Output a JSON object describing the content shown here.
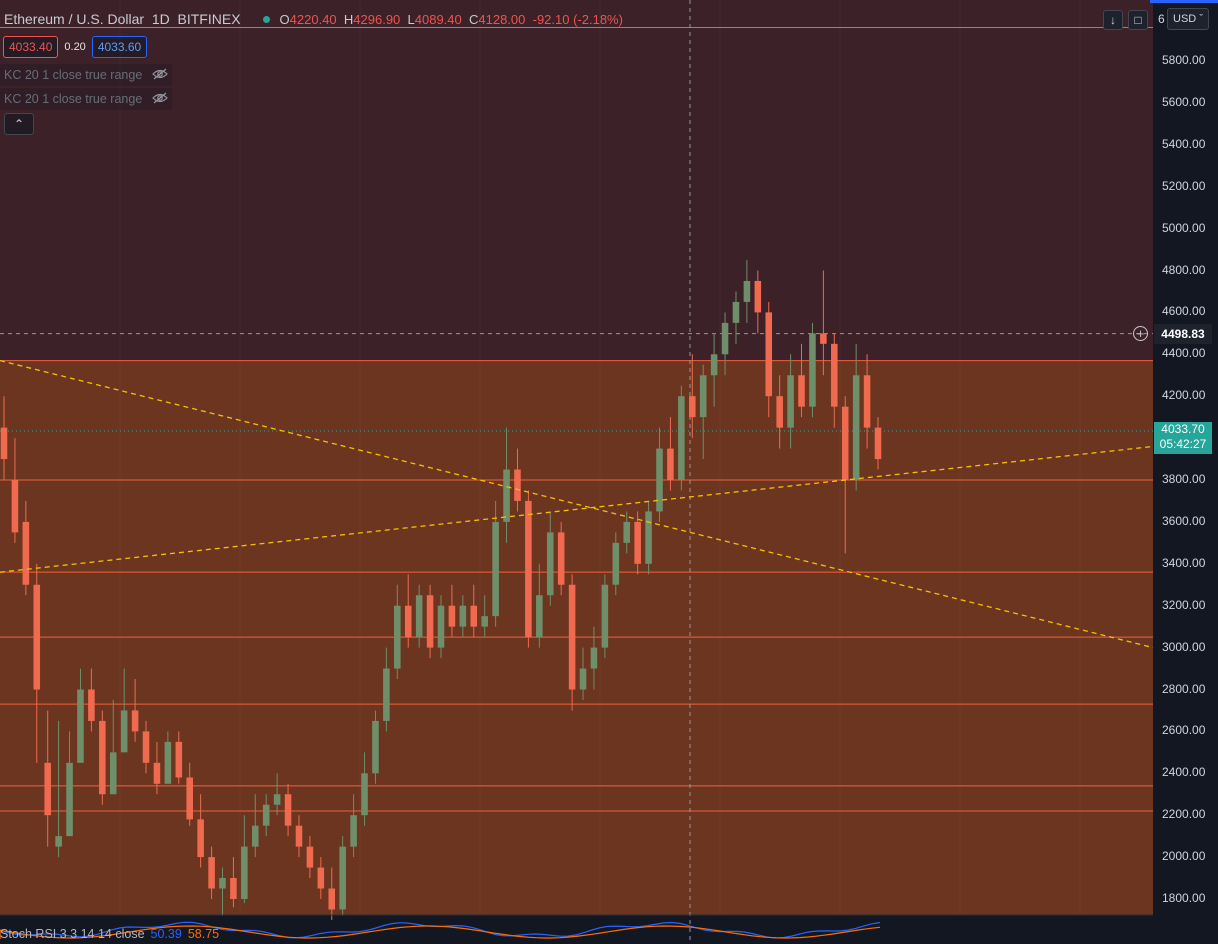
{
  "header": {
    "symbol": "Ethereum / U.S. Dollar",
    "interval": "1D",
    "exchange": "BITFINEX",
    "open_key": "O",
    "open_val": "4220.40",
    "high_key": "H",
    "high_val": "4296.90",
    "low_key": "L",
    "low_val": "4089.40",
    "close_key": "C",
    "close_val": "4128.00",
    "change": "-92.10 (-2.18%)"
  },
  "trade": {
    "bid": "4033.40",
    "spread": "0.20",
    "ask": "4033.60"
  },
  "indicators": [
    "KC 20 1 close true range",
    "KC 20 1 close true range"
  ],
  "currency": "USD",
  "axis": {
    "top_digit": "6",
    "labels": [
      "5800.00",
      "5600.00",
      "5400.00",
      "5200.00",
      "5000.00",
      "4800.00",
      "4600.00",
      "4400.00",
      "4200.00",
      "3800.00",
      "3600.00",
      "3400.00",
      "3200.00",
      "3000.00",
      "2800.00",
      "2600.00",
      "2400.00",
      "2200.00",
      "2000.00",
      "1800.00"
    ]
  },
  "crosshair_price": "4498.83",
  "last_price": "4033.70",
  "countdown": "05:42:27",
  "stoch": {
    "label": "Stoch RSI 3 3 14 14 close",
    "k": "50.39",
    "d": "58.75"
  },
  "colors": {
    "background": "#131722",
    "upper_zone": "#3c2128",
    "lower_zone": "#6b3520",
    "up_candle": "#6f8f6a",
    "down_candle": "#f06a4f",
    "level_line": "#f2613d",
    "trendline": "#f5c100",
    "last_price_tag": "#26a69a"
  },
  "chart_data": {
    "type": "candlestick",
    "symbol": "Ethereum / U.S. Dollar",
    "interval": "1D",
    "y_range": [
      1700,
      6000
    ],
    "horizontal_levels": [
      5960,
      4370,
      3800,
      3360,
      3050,
      2730,
      2340,
      2220
    ],
    "trendlines": [
      {
        "from": [
          0,
          4370
        ],
        "to": [
          1.0,
          3000
        ]
      },
      {
        "from": [
          0,
          3360
        ],
        "to": [
          1.0,
          3960
        ]
      }
    ],
    "last_price": 4033.7,
    "crosshair_price": 4498.83,
    "candles": [
      [
        4050,
        4200,
        3900,
        3800
      ],
      [
        3800,
        4000,
        3550,
        3500
      ],
      [
        3600,
        3700,
        3300,
        3250
      ],
      [
        3300,
        3400,
        2800,
        2450
      ],
      [
        2450,
        2700,
        2200,
        2050
      ],
      [
        2050,
        2650,
        2100,
        2000
      ],
      [
        2100,
        2600,
        2450,
        2400
      ],
      [
        2450,
        2900,
        2800,
        2700
      ],
      [
        2800,
        2900,
        2650,
        2600
      ],
      [
        2650,
        2700,
        2300,
        2250
      ],
      [
        2300,
        2750,
        2500,
        2450
      ],
      [
        2500,
        2900,
        2700,
        2650
      ],
      [
        2700,
        2850,
        2600,
        2550
      ],
      [
        2600,
        2650,
        2450,
        2400
      ],
      [
        2450,
        2550,
        2350,
        2300
      ],
      [
        2350,
        2600,
        2550,
        2500
      ],
      [
        2550,
        2600,
        2380,
        2350
      ],
      [
        2380,
        2450,
        2180,
        2150
      ],
      [
        2180,
        2300,
        2000,
        1950
      ],
      [
        2000,
        2050,
        1850,
        1800
      ],
      [
        1850,
        1950,
        1900,
        1720
      ],
      [
        1900,
        2000,
        1800,
        1760
      ],
      [
        1800,
        2200,
        2050,
        1780
      ],
      [
        2050,
        2300,
        2150,
        2000
      ],
      [
        2150,
        2300,
        2250,
        2100
      ],
      [
        2250,
        2400,
        2300,
        2200
      ],
      [
        2300,
        2350,
        2150,
        2100
      ],
      [
        2150,
        2200,
        2050,
        2000
      ],
      [
        2050,
        2100,
        1950,
        1900
      ],
      [
        1950,
        2000,
        1850,
        1800
      ],
      [
        1850,
        1950,
        1750,
        1700
      ],
      [
        1750,
        2100,
        2050,
        1720
      ],
      [
        2050,
        2300,
        2200,
        2000
      ],
      [
        2200,
        2500,
        2400,
        2150
      ],
      [
        2400,
        2700,
        2650,
        2350
      ],
      [
        2650,
        3000,
        2900,
        2600
      ],
      [
        2900,
        3300,
        3200,
        2850
      ],
      [
        3200,
        3350,
        3050,
        3000
      ],
      [
        3050,
        3300,
        3250,
        3000
      ],
      [
        3250,
        3300,
        3000,
        2950
      ],
      [
        3000,
        3250,
        3200,
        2950
      ],
      [
        3200,
        3300,
        3100,
        3050
      ],
      [
        3100,
        3250,
        3200,
        3050
      ],
      [
        3200,
        3300,
        3100,
        3050
      ],
      [
        3100,
        3250,
        3150,
        3050
      ],
      [
        3150,
        3700,
        3600,
        3100
      ],
      [
        3600,
        4050,
        3850,
        3500
      ],
      [
        3850,
        3950,
        3700,
        3650
      ],
      [
        3700,
        3750,
        3050,
        3000
      ],
      [
        3050,
        3400,
        3250,
        3000
      ],
      [
        3250,
        3650,
        3550,
        3200
      ],
      [
        3550,
        3600,
        3300,
        3250
      ],
      [
        3300,
        3350,
        2800,
        2700
      ],
      [
        2800,
        3000,
        2900,
        2750
      ],
      [
        2900,
        3100,
        3000,
        2800
      ],
      [
        3000,
        3350,
        3300,
        2950
      ],
      [
        3300,
        3550,
        3500,
        3250
      ],
      [
        3500,
        3650,
        3600,
        3450
      ],
      [
        3600,
        3650,
        3400,
        3350
      ],
      [
        3400,
        3700,
        3650,
        3350
      ],
      [
        3650,
        4050,
        3950,
        3600
      ],
      [
        3950,
        4100,
        3800,
        3750
      ],
      [
        3800,
        4250,
        4200,
        3750
      ],
      [
        4200,
        4400,
        4100,
        4000
      ],
      [
        4100,
        4350,
        4300,
        3900
      ],
      [
        4300,
        4500,
        4400,
        4150
      ],
      [
        4400,
        4600,
        4550,
        4300
      ],
      [
        4550,
        4700,
        4650,
        4450
      ],
      [
        4650,
        4850,
        4750,
        4550
      ],
      [
        4750,
        4800,
        4600,
        4500
      ],
      [
        4600,
        4650,
        4200,
        4100
      ],
      [
        4200,
        4300,
        4050,
        3950
      ],
      [
        4050,
        4400,
        4300,
        3950
      ],
      [
        4300,
        4450,
        4150,
        4100
      ],
      [
        4150,
        4550,
        4500,
        4100
      ],
      [
        4500,
        4800,
        4450,
        4300
      ],
      [
        4450,
        4500,
        4150,
        4050
      ],
      [
        4150,
        4200,
        3800,
        3450
      ],
      [
        3800,
        4450,
        4300,
        3750
      ],
      [
        4300,
        4400,
        4050,
        3950
      ],
      [
        4050,
        4100,
        3900,
        3850
      ]
    ]
  }
}
